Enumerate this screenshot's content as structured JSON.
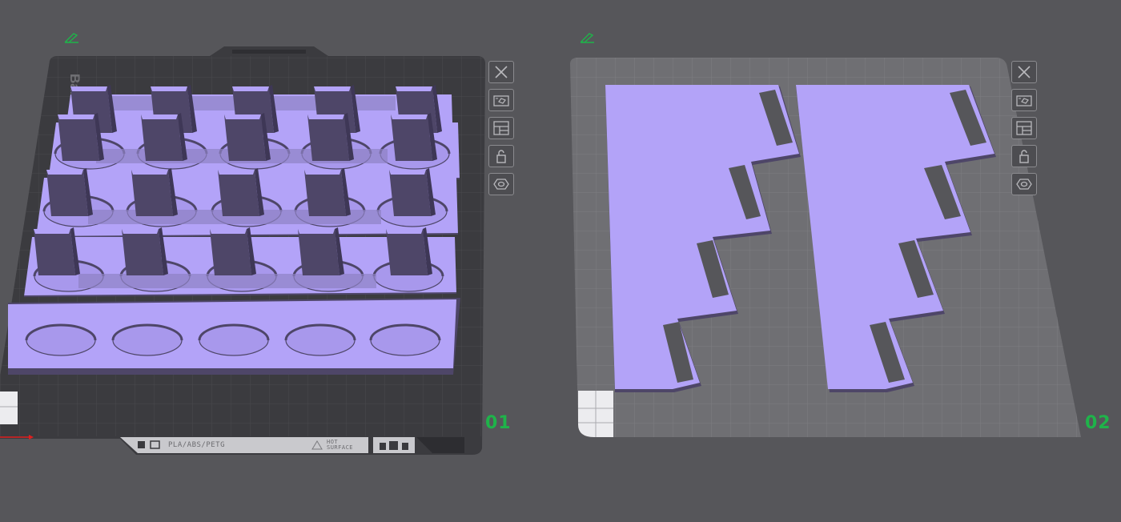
{
  "plates": [
    {
      "label": "01",
      "bed_type": "textured",
      "bed_strip": {
        "filament_text": "PLA/ABS/PETG",
        "warning_text": "HOT SURFACE"
      },
      "toolbar": [
        {
          "name": "close-plate-button",
          "icon": "close-icon"
        },
        {
          "name": "auto-orient-button",
          "icon": "orient-icon"
        },
        {
          "name": "arrange-button",
          "icon": "arrange-icon"
        },
        {
          "name": "lock-plate-button",
          "icon": "lock-icon"
        },
        {
          "name": "plate-settings-button",
          "icon": "settings-icon"
        }
      ]
    },
    {
      "label": "02",
      "bed_type": "smooth",
      "toolbar": [
        {
          "name": "close-plate-button",
          "icon": "close-icon"
        },
        {
          "name": "auto-orient-button",
          "icon": "orient-icon"
        },
        {
          "name": "arrange-button",
          "icon": "arrange-icon"
        },
        {
          "name": "lock-plate-button",
          "icon": "lock-icon"
        },
        {
          "name": "plate-settings-button",
          "icon": "settings-icon"
        }
      ]
    }
  ],
  "colors": {
    "background": "#56565a",
    "model": "#b3a3f8",
    "model_shade": "#4e4668",
    "bed_dark": "#3b3b3f",
    "bed_light": "#6f6f73",
    "label": "#1fb34a",
    "edit_icon": "#1fb34a"
  }
}
